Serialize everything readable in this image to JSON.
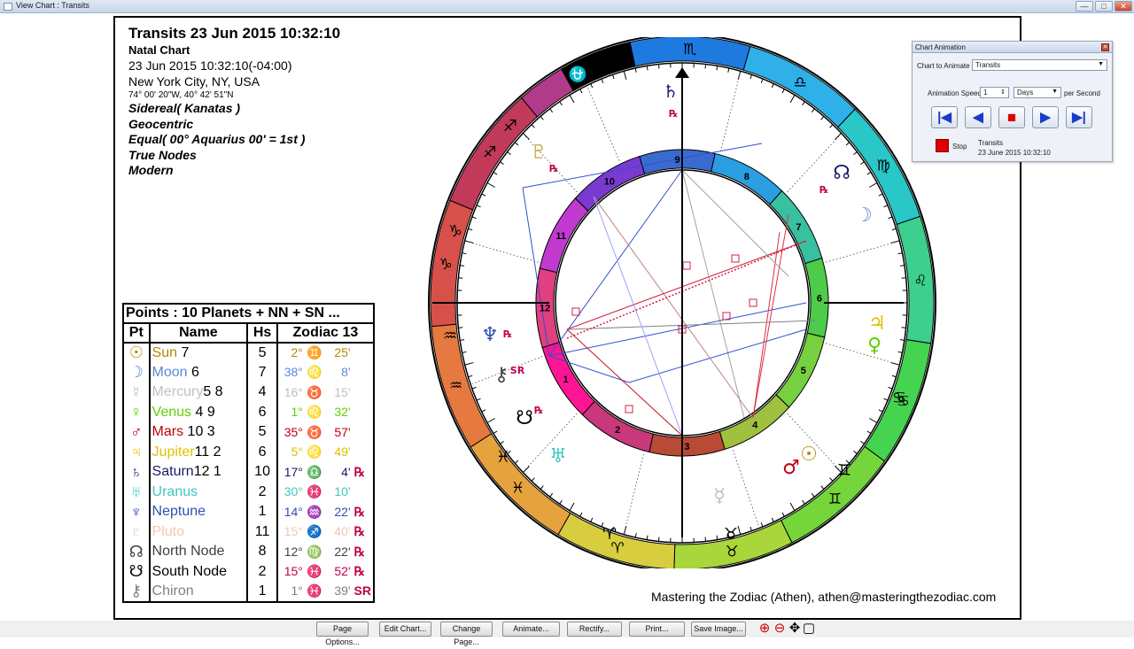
{
  "window": {
    "title": "View Chart : Transits",
    "min_label": "—",
    "max_label": "□",
    "close_label": "✕"
  },
  "header": {
    "title": "Transits 23 Jun 2015 10:32:10",
    "subtitle": "Natal Chart",
    "datetime": "23 Jun 2015 10:32:10(-04:00)",
    "place": "New York City, NY, USA",
    "coords": "74° 00' 20\"W, 40° 42' 51\"N",
    "settings": [
      "Sidereal( Kanatas )",
      "Geocentric",
      "Equal( 00° Aquarius 00' = 1st )",
      "True Nodes",
      "Modern"
    ]
  },
  "points_table": {
    "caption": "Points : 10 Planets + NN + SN ...",
    "headers": [
      "Pt",
      "Name",
      "Hs",
      "Zodiac 13"
    ],
    "rows": [
      {
        "glyph": "☉",
        "name": "Sun",
        "extra": " 7",
        "hs": "5",
        "deg": "2°",
        "sign": "♊",
        "min": "25'",
        "flag": "",
        "color": "#b8860b"
      },
      {
        "glyph": "☽",
        "name": "Moon",
        "extra": " 6",
        "hs": "7",
        "deg": "38°",
        "sign": "♌",
        "min": "8'",
        "flag": "",
        "color": "#5a8ad8"
      },
      {
        "glyph": "☿",
        "name": "Mercury",
        "extra": "5 8",
        "hs": "4",
        "deg": "16°",
        "sign": "♉",
        "min": "15'",
        "flag": "",
        "color": "#c0c0c0"
      },
      {
        "glyph": "♀",
        "name": "Venus",
        "extra": " 4  9",
        "hs": "6",
        "deg": "1°",
        "sign": "♌",
        "min": "32'",
        "flag": "",
        "color": "#60d000"
      },
      {
        "glyph": "♂",
        "name": "Mars",
        "extra": " 10 3",
        "hs": "5",
        "deg": "35°",
        "sign": "♉",
        "min": "57'",
        "flag": "",
        "color": "#c00010"
      },
      {
        "glyph": "♃",
        "name": "Jupiter",
        "extra": "11 2",
        "hs": "6",
        "deg": "5°",
        "sign": "♌",
        "min": "49'",
        "flag": "",
        "color": "#e0c000"
      },
      {
        "glyph": "♄",
        "name": "Saturn",
        "extra": "12 1",
        "hs": "10",
        "deg": "17°",
        "sign": "♎",
        "min": "4'",
        "flag": "℞",
        "color": "#1a1a6a"
      },
      {
        "glyph": "♅",
        "name": "Uranus",
        "extra": "",
        "hs": "2",
        "deg": "30°",
        "sign": "♓",
        "min": "10'",
        "flag": "",
        "color": "#40c8c0"
      },
      {
        "glyph": "♆",
        "name": "Neptune",
        "extra": "",
        "hs": "1",
        "deg": "14°",
        "sign": "♒",
        "min": "22'",
        "flag": "℞",
        "color": "#3050b0"
      },
      {
        "glyph": "♇",
        "name": "Pluto",
        "extra": "",
        "hs": "11",
        "deg": "15°",
        "sign": "♐",
        "min": "40'",
        "flag": "℞",
        "color": "#f0c8b0"
      },
      {
        "glyph": "☊",
        "name": "North Node",
        "extra": "",
        "hs": "8",
        "deg": "12°",
        "sign": "♍",
        "min": "22'",
        "flag": "℞",
        "color": "#404040"
      },
      {
        "glyph": "☋",
        "name": "South Node",
        "extra": "",
        "hs": "2",
        "deg": "15°",
        "sign": "♓",
        "min": "52'",
        "flag": "℞",
        "color": "#000000"
      },
      {
        "glyph": "⚷",
        "name": "Chiron",
        "extra": "",
        "hs": "1",
        "deg": "1°",
        "sign": "♓",
        "min": "39'",
        "flag": "SR",
        "color": "#808080"
      }
    ]
  },
  "wheel": {
    "signs": [
      "♏",
      "♎",
      "♍",
      "♌",
      "♋",
      "♊",
      "♉",
      "♈",
      "♓",
      "♒",
      "♑",
      "♐",
      "⛎"
    ],
    "houses": [
      "1",
      "2",
      "3",
      "4",
      "5",
      "6",
      "7",
      "8",
      "9",
      "10",
      "11",
      "12"
    ],
    "transit_glyphs": [
      "♄",
      "℞",
      "☊",
      "℞",
      "☽",
      "♃",
      "♀",
      "♋",
      "♊",
      "☉",
      "♂",
      "☿",
      "♉",
      "♈",
      "♅",
      "♓",
      "☋",
      "℞",
      "⚷",
      "SR",
      "♆",
      "℞",
      "♒",
      "♑",
      "♇",
      "℞",
      "♐"
    ]
  },
  "animation": {
    "title": "Chart Animation",
    "close": "✕",
    "chart_label": "Chart to Animate :",
    "chart_value": "Transits",
    "speed_label": "Animation Speed :",
    "speed_value": "1",
    "unit_value": "Days",
    "per_label": "per Second",
    "buttons": [
      "|◀",
      "◀",
      "■",
      "▶",
      "▶|"
    ],
    "status_label": "Stop",
    "status_title": "Transits",
    "status_date": "23 June 2015 10:32:10"
  },
  "footer": "Mastering the Zodiac (Athen), athen@masteringthezodiac.com",
  "toolbar": {
    "buttons": [
      "Page Options...",
      "Edit Chart...",
      "Change Page...",
      "Animate...",
      "Rectify...",
      "Print...",
      "Save Image..."
    ],
    "zoom_in": "⊕",
    "zoom_out": "⊖",
    "move": "✥",
    "fit": "▢"
  }
}
